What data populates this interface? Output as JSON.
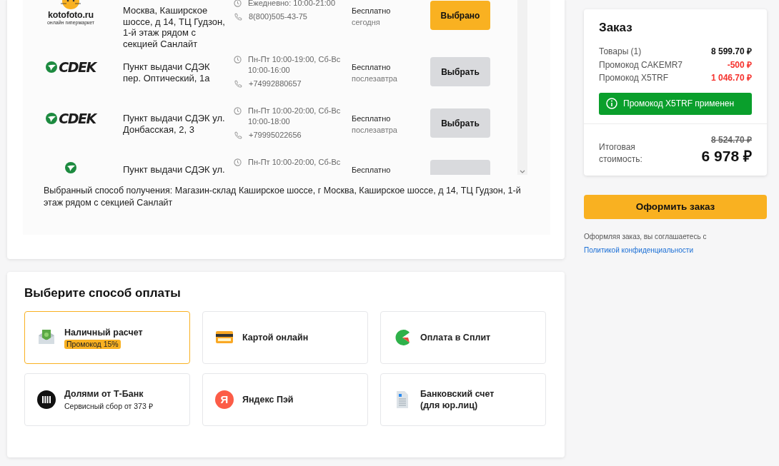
{
  "pickup": {
    "points": [
      {
        "logo": {
          "kind": "kotofoto",
          "name": "kotofoto.ru",
          "tagline": "онлайн гипермаркет"
        },
        "address": "Москва, Каширское шоссе, д 14, ТЦ Гудзон, 1-й этаж рядом с секцией Санлайт",
        "hours": "Ежедневно: 10:00-21:00",
        "phone": "8(800)505-43-75",
        "price": "Бесплатно",
        "when": "сегодня",
        "button": "Выбрано",
        "selected": true
      },
      {
        "logo": {
          "kind": "cdek",
          "name": "CDEK"
        },
        "address": "Пункт выдачи СДЭК пер. Оптический, 1а",
        "hours": "Пн-Пт 10:00-19:00, Сб-Вс 10:00-16:00",
        "phone": "+74992880657",
        "price": "Бесплатно",
        "when": "послезавтра",
        "button": "Выбрать",
        "selected": false
      },
      {
        "logo": {
          "kind": "cdek",
          "name": "CDEK"
        },
        "address": "Пункт выдачи СДЭК ул. Донбасская, 2, 3",
        "hours": "Пн-Пт 10:00-20:00, Сб-Вс 10:00-18:00",
        "phone": "+79995022656",
        "price": "Бесплатно",
        "when": "послезавтра",
        "button": "Выбрать",
        "selected": false
      },
      {
        "logo": {
          "kind": "cdek"
        },
        "address": "Пункт выдачи СДЭК ул.",
        "hours": "Пн-Пт 10:00-20:00, Сб-Вс",
        "price": "Бесплатно",
        "selected": false
      }
    ],
    "selected_text": "Выбранный способ получения: Магазин-склад Каширское шоссе, г Москва, Каширское шоссе, д 14, ТЦ Гудзон, 1-й этаж рядом с секцией Санлайт"
  },
  "payment": {
    "title": "Выберите способ оплаты",
    "methods": [
      {
        "kind": "cash",
        "title": "Наличный расчет",
        "badge": "Промокод 15%",
        "selected": true
      },
      {
        "kind": "card",
        "title": "Картой онлайн",
        "selected": false
      },
      {
        "kind": "split",
        "title": "Оплата в Сплит",
        "selected": false
      },
      {
        "kind": "dolyami",
        "title": "Долями от Т-Банк",
        "note": "Сервисный сбор от 373 ₽",
        "selected": false
      },
      {
        "kind": "yandex",
        "title": "Яндекс Пэй",
        "logo_text": "Я",
        "selected": false
      },
      {
        "kind": "invoice",
        "title": "Банковский счет (для юр.лиц)",
        "selected": false
      }
    ]
  },
  "order": {
    "title": "Заказ",
    "lines": [
      {
        "kind": "sum",
        "label": "Товары (1)",
        "value": "8 599.70 ₽"
      },
      {
        "kind": "discount",
        "label": "Промокод CAKEMR7",
        "value": "-500 ₽"
      },
      {
        "kind": "discount",
        "label": "Промокод X5TRF",
        "value": "1 046.70 ₽"
      }
    ],
    "notice": "Промокод X5TRF применен",
    "total_label": "Итоговая стоимость:",
    "old_total": "8 524.70 ₽",
    "total": "6 978 ₽",
    "checkout": "Оформить заказ",
    "consent": "Оформляя заказ, вы соглашаетесь с",
    "consent_link": "Политикой конфиденциальности"
  }
}
